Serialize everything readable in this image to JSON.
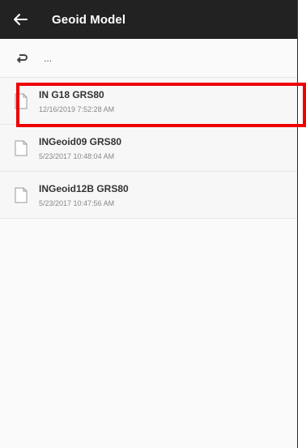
{
  "appbar": {
    "title": "Geoid Model",
    "back_icon": "arrow-left-icon"
  },
  "up_row": {
    "icon": "return-icon",
    "label": "..."
  },
  "files": [
    {
      "name": "IN G18 GRS80",
      "date": "12/16/2019 7:52:28 AM",
      "icon": "file-icon",
      "highlighted": true
    },
    {
      "name": "INGeoid09 GRS80",
      "date": "5/23/2017 10:48:04 AM",
      "icon": "file-icon",
      "highlighted": false
    },
    {
      "name": "INGeoid12B GRS80",
      "date": "5/23/2017 10:47:56 AM",
      "icon": "file-icon",
      "highlighted": false
    }
  ],
  "colors": {
    "appbar_bg": "#222222",
    "highlight": "#ee0000",
    "background": "#fafafa"
  }
}
